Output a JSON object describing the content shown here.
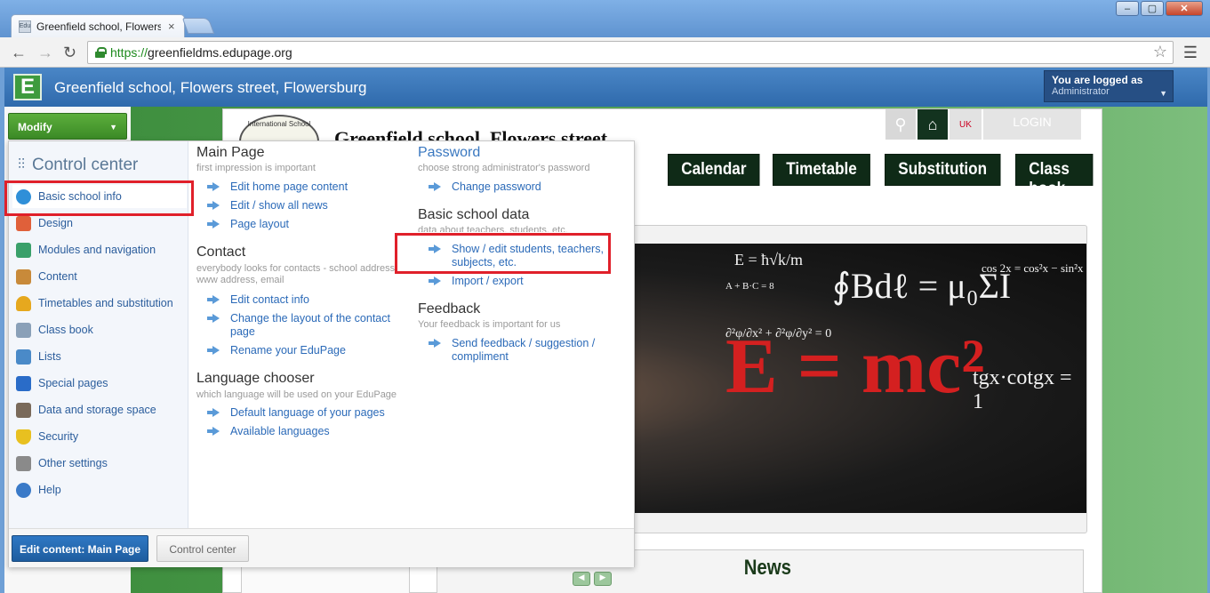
{
  "browser": {
    "tab_title": "Greenfield school, Flowers st",
    "tab_favicon": "Edu",
    "url_scheme": "https://",
    "url_host": "greenfieldms.edupage.org",
    "window_buttons": [
      "–",
      "▢",
      "✕"
    ]
  },
  "header": {
    "logo_letter": "E",
    "title": "Greenfield school, Flowers street, Flowersburg",
    "logged_label": "You are logged as",
    "logged_role": "Administrator"
  },
  "modify_button": "Modify",
  "site": {
    "title": "Greenfield school, Flowers street",
    "seal_text": "International School",
    "login": "LOGIN",
    "flag": "UK",
    "nav": [
      "Calendar",
      "Timetable",
      "Substitution",
      "Class book"
    ],
    "news_title": "News",
    "hero_equation": "E = mc²",
    "hero_scribbles": [
      "E = ħ√k/m",
      "∮Bdℓ = μ₀ΣI",
      "cos 2x = cos²x − sin²x",
      "tgx·cotgx = 1",
      "A + B·C = 8",
      "∂²φ/∂x² + ∂²φ/∂y² = 0"
    ]
  },
  "control_center": {
    "title": "Control center",
    "menu": [
      {
        "label": "Basic school info",
        "icon": "globe-icon",
        "color": "#2f8fd8"
      },
      {
        "label": "Design",
        "icon": "palette-icon",
        "color": "#e0603a"
      },
      {
        "label": "Modules and navigation",
        "icon": "modules-icon",
        "color": "#3aa06a"
      },
      {
        "label": "Content",
        "icon": "content-icon",
        "color": "#c88a3a"
      },
      {
        "label": "Timetables and substitution",
        "icon": "bell-icon",
        "color": "#e6a81e"
      },
      {
        "label": "Class book",
        "icon": "book-icon",
        "color": "#8aa0b8"
      },
      {
        "label": "Lists",
        "icon": "list-icon",
        "color": "#4a8ac8"
      },
      {
        "label": "Special pages",
        "icon": "cube-icon",
        "color": "#2a6cc8"
      },
      {
        "label": "Data and storage space",
        "icon": "storage-icon",
        "color": "#7a6a5a"
      },
      {
        "label": "Security",
        "icon": "shield-icon",
        "color": "#e8c020"
      },
      {
        "label": "Other settings",
        "icon": "tools-icon",
        "color": "#8a8a8a"
      },
      {
        "label": "Help",
        "icon": "help-icon",
        "color": "#3a7ac8"
      }
    ],
    "sections": {
      "main_page": {
        "title": "Main Page",
        "desc": "first impression is important",
        "links": [
          "Edit home page content",
          "Edit / show all news",
          "Page layout"
        ]
      },
      "contact": {
        "title": "Contact",
        "desc": "everybody looks for contacts - school address, www address, email",
        "links": [
          "Edit contact info",
          "Change the layout of the contact page",
          "Rename your EduPage"
        ]
      },
      "language": {
        "title": "Language chooser",
        "desc": "which language will be used on your EduPage",
        "links": [
          "Default language of your pages",
          "Available languages"
        ]
      },
      "password": {
        "title": "Password",
        "desc": "choose strong administrator's password",
        "links": [
          "Change password"
        ]
      },
      "basic_data": {
        "title": "Basic school data",
        "desc": "data about teachers, students, etc.",
        "links": [
          "Show / edit students, teachers, subjects, etc.",
          "Import / export"
        ]
      },
      "feedback": {
        "title": "Feedback",
        "desc": "Your feedback is important for us",
        "links": [
          "Send feedback / suggestion / compliment"
        ]
      }
    },
    "footer": {
      "edit_main": "Edit content: Main Page",
      "control_center": "Control center"
    }
  },
  "colors": {
    "header_blue": "#2f6aac",
    "nav_green": "#0f2a17",
    "highlight_red": "#e0202a",
    "link_blue": "#2b6ab8"
  }
}
